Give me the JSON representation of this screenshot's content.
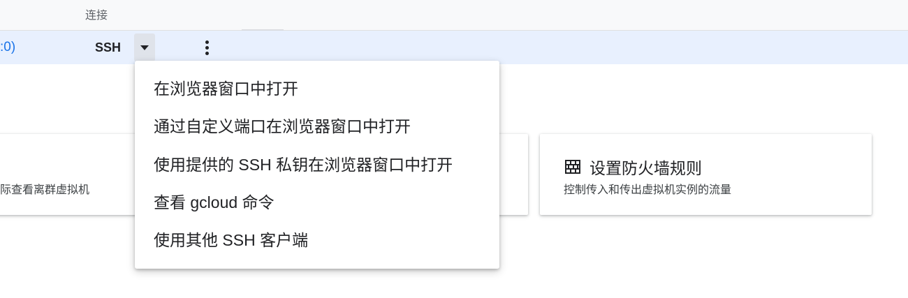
{
  "table": {
    "header": {
      "connect_label": "连接"
    },
    "row": {
      "ip_fragment": ":0)",
      "ssh_label": "SSH"
    }
  },
  "ssh_menu": {
    "items": [
      {
        "label": "在浏览器窗口中打开"
      },
      {
        "label": "通过自定义端口在浏览器窗口中打开"
      },
      {
        "label": "使用提供的 SSH 私钥在浏览器窗口中打开"
      },
      {
        "label": "查看 gcloud 命令"
      },
      {
        "label": "使用其他 SSH 客户端"
      }
    ]
  },
  "cards": {
    "left": {
      "description": "际查看离群虚拟机"
    },
    "right": {
      "icon": "firewall-icon",
      "title": "设置防火墙规则",
      "description": "控制传入和传出虚拟机实例的流量"
    }
  },
  "colors": {
    "link": "#1a73e8",
    "selected_row": "#e8f0fe",
    "header_bg": "#f8f9fa"
  }
}
